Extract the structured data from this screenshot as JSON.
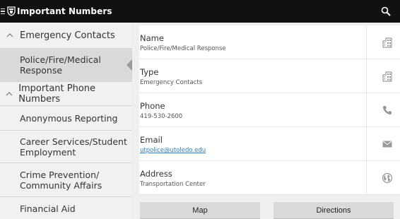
{
  "appbar": {
    "title": "Important Numbers",
    "icons": [
      "drawer-icon",
      "shield-logo-icon",
      "search-icon"
    ]
  },
  "list": {
    "groups": [
      {
        "header": "Emergency Contacts",
        "items": [
          "Police/Fire/Medical Response"
        ]
      },
      {
        "header": "Important Phone Numbers",
        "items": [
          "Anonymous Reporting",
          "Career Services/Student Employment",
          "Crime Prevention/ Community Affairs",
          "Financial Aid"
        ]
      }
    ],
    "selected_item": "Police/Fire/Medical Response"
  },
  "detail": {
    "rows": [
      {
        "label": "Name",
        "value": "Police/Fire/Medical Response",
        "icon": "building-icon"
      },
      {
        "label": "Type",
        "value": "Emergency Contacts",
        "icon": "building-icon"
      },
      {
        "label": "Phone",
        "value": "419-530-2600",
        "icon": "phone-icon"
      },
      {
        "label": "Email",
        "value": "utpolice@utoledo.edu",
        "icon": "email-icon"
      },
      {
        "label": "Address",
        "value": "Transportation Center",
        "icon": "globe-icon"
      }
    ],
    "buttons": {
      "map": "Map",
      "directions": "Directions"
    }
  },
  "colors": {
    "appbar_bg": "#111111",
    "link": "#2a7fbf",
    "selected_bg": "#d9d9d9",
    "button_bg": "#d9d9d9"
  }
}
